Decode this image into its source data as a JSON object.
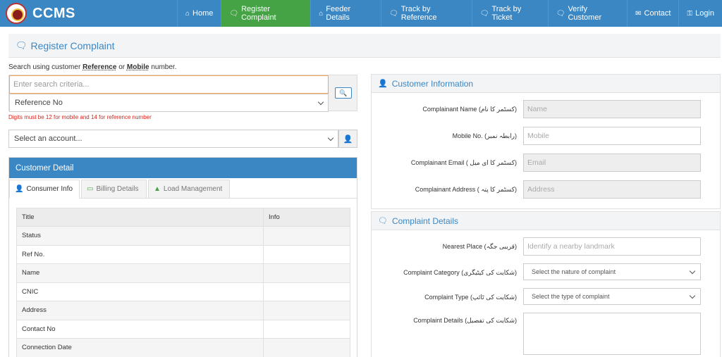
{
  "brand": {
    "name": "CCMS"
  },
  "nav": [
    {
      "label": "Home",
      "icon": "home-icon",
      "glyph": "⌂"
    },
    {
      "label": "Register Complaint",
      "icon": "comments-icon",
      "glyph": "🗨"
    },
    {
      "label": "Feeder Details",
      "icon": "home-icon",
      "glyph": "⌂"
    },
    {
      "label": "Track by Reference",
      "icon": "comments-icon",
      "glyph": "🗨"
    },
    {
      "label": "Track by Ticket",
      "icon": "comments-icon",
      "glyph": "🗨"
    },
    {
      "label": "Verify Customer",
      "icon": "comments-icon",
      "glyph": "🗨"
    },
    {
      "label": "Contact",
      "icon": "envelope-icon",
      "glyph": "✉"
    },
    {
      "label": "Login",
      "icon": "key-icon",
      "glyph": "⚿"
    }
  ],
  "nav_active_index": 1,
  "page": {
    "title": "Register Complaint"
  },
  "search": {
    "hint_prefix": "Search using customer ",
    "hint_ref": "Reference",
    "hint_or": " or ",
    "hint_mobile": "Mobile",
    "hint_suffix": " number.",
    "placeholder": "Enter search criteria...",
    "type_selected": "Reference No",
    "error": "Digits must be 12 for mobile and 14 for reference number",
    "account_placeholder": "Select an account..."
  },
  "customer_detail": {
    "title": "Customer Detail",
    "tabs": [
      {
        "label": "Consumer Info",
        "icon": "user-icon"
      },
      {
        "label": "Billing Details",
        "icon": "credit-card-icon"
      },
      {
        "label": "Load Management",
        "icon": "road-icon"
      }
    ],
    "columns": [
      "Title",
      "Info"
    ],
    "rows": [
      "Status",
      "Ref No.",
      "Name",
      "CNIC",
      "Address",
      "Contact No",
      "Connection Date"
    ]
  },
  "customer_info": {
    "title": "Customer Information",
    "fields": [
      {
        "label": "Complainant Name (کسٹمر کا نام)",
        "placeholder": "Name"
      },
      {
        "label": "Mobile No. (رابطہ نمبر)",
        "placeholder": "Mobile"
      },
      {
        "label": "Complainant Email ( کسٹمر کا ای میل)",
        "placeholder": "Email"
      },
      {
        "label": "Complainant Address ( کسٹمر کا پتہ)",
        "placeholder": "Address"
      }
    ]
  },
  "complaint_details": {
    "title": "Complaint Details",
    "nearest_label": "Nearest Place (قریبی جگہ)",
    "nearest_placeholder": "Identify a nearby landmark",
    "category_label": "Complaint Category (شکایت کی کیٹیگری)",
    "category_selected": "Select the nature of complaint",
    "type_label": "Complaint Type (شکایت کی ٹائپ)",
    "type_selected": "Select the type of complaint",
    "details_label": "Complaint Details (شکایت کی تفصیل)"
  },
  "colors": {
    "primary": "#3a87c4",
    "active_nav": "#45a345",
    "error": "#d9231b",
    "focus": "#f0a64a"
  }
}
